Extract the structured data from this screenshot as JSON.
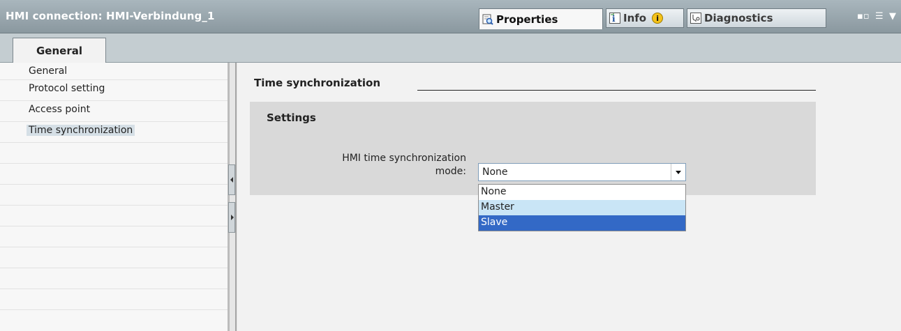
{
  "window": {
    "title": "HMI connection: HMI-Verbindung_1",
    "tabs": [
      {
        "label": "Properties",
        "icon": "properties-icon"
      },
      {
        "label": "Info",
        "icon": "info-icon",
        "badge": "i"
      },
      {
        "label": "Diagnostics",
        "icon": "diagnostics-icon"
      }
    ],
    "controls": [
      "restore-icon",
      "list-icon",
      "chevron-down-icon"
    ]
  },
  "tabbar": {
    "active_tab": "General"
  },
  "nav": {
    "items": [
      {
        "label": "General"
      },
      {
        "label": "Protocol setting"
      },
      {
        "label": "Access point"
      },
      {
        "label": "Time synchronization",
        "selected": true
      }
    ]
  },
  "main": {
    "section_title": "Time synchronization",
    "panel_title": "Settings",
    "field_label_line1": "HMI time synchronization",
    "field_label_line2": "mode:",
    "combo_value": "None",
    "options": [
      "None",
      "Master",
      "Slave"
    ],
    "hovered_option": "Master",
    "selected_option": "Slave"
  },
  "colors": {
    "titlebar": "#9aa7ae",
    "selection": "#3369c6",
    "hover": "#c9e5f6",
    "panel": "#d9d9d9"
  }
}
